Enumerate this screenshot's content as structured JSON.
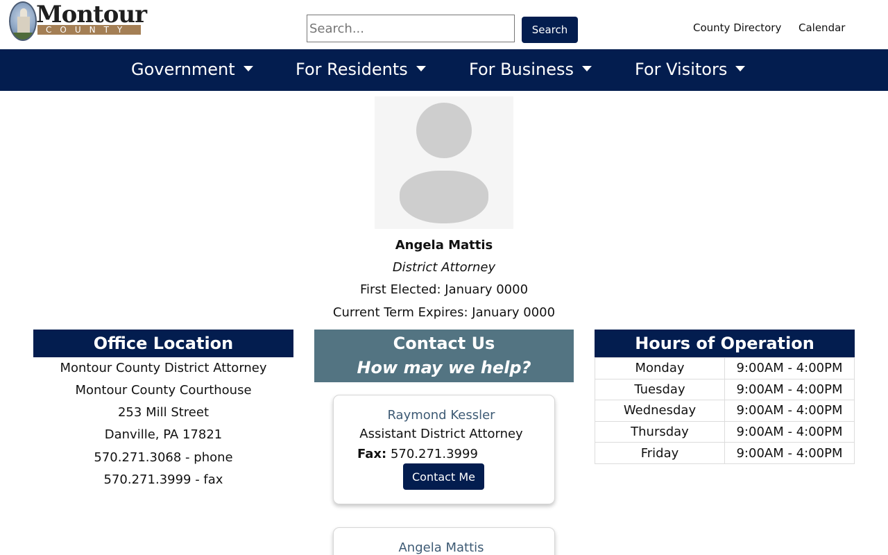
{
  "header": {
    "logo": {
      "word": "Montour",
      "sub": "COUNTY"
    },
    "search": {
      "placeholder": "Search...",
      "button_label": "Search"
    },
    "links": [
      "County Directory",
      "Calendar"
    ]
  },
  "nav": {
    "items": [
      {
        "label": "Government"
      },
      {
        "label": "For Residents"
      },
      {
        "label": "For Business"
      },
      {
        "label": "For Visitors"
      }
    ]
  },
  "profile": {
    "name": "Angela Mattis",
    "title": "District Attorney",
    "first_elected": "First Elected: January 0000",
    "term_expires": "Current Term Expires: January 0000"
  },
  "office": {
    "heading": "Office Location",
    "lines": [
      "Montour County District Attorney",
      "Montour County Courthouse",
      "253 Mill Street",
      "Danville, PA  17821",
      "570.271.3068 - phone",
      "570.271.3999 - fax"
    ]
  },
  "contact": {
    "heading": "Contact Us",
    "subheading": "How may we help?",
    "cards": [
      {
        "name": "Raymond Kessler",
        "role": "Assistant District Attorney",
        "fax_label": "Fax:",
        "fax": "570.271.3999",
        "button_label": "Contact Me"
      },
      {
        "name": "Angela Mattis"
      }
    ]
  },
  "hours": {
    "heading": "Hours of Operation",
    "rows": [
      {
        "day": "Monday",
        "time": "9:00AM - 4:00PM"
      },
      {
        "day": "Tuesday",
        "time": "9:00AM - 4:00PM"
      },
      {
        "day": "Wednesday",
        "time": "9:00AM - 4:00PM"
      },
      {
        "day": "Thursday",
        "time": "9:00AM - 4:00PM"
      },
      {
        "day": "Friday",
        "time": "9:00AM - 4:00PM"
      }
    ]
  },
  "colors": {
    "navy": "#031d4f",
    "slate": "#537482",
    "link_blue": "#3d5a74",
    "logo_tan": "#a47f55"
  }
}
